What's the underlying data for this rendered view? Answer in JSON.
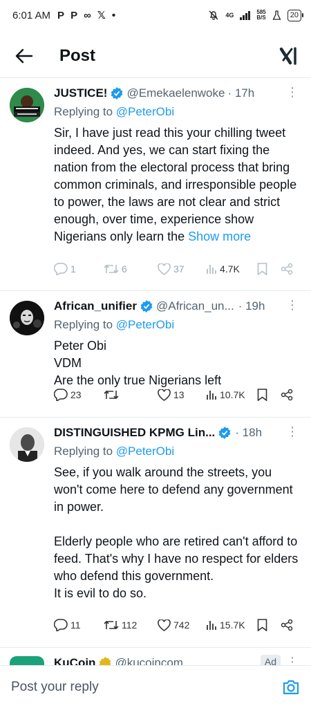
{
  "status": {
    "time": "6:01 AM",
    "left_icons": [
      "P",
      "P",
      "∞",
      "𝕏",
      "•"
    ],
    "net_gen": "4G",
    "net_speed_top": "585",
    "net_speed_bottom": "B/S",
    "battery": "20"
  },
  "header": {
    "title": "Post",
    "logo": "xl"
  },
  "tweets": [
    {
      "name": "JUSTICE!",
      "handle": "@Emekaelenwoke",
      "time": "· 17h",
      "reply_prefix": "Replying to ",
      "reply_to": "@PeterObi",
      "text": "Sir, I have just read this your chilling tweet indeed. And yes, we can start fixing the nation from the electoral process that bring common criminals, and irresponsible people to power, the laws are not clear and strict enough, over time, experience show Nigerians only learn the ",
      "show_more": "Show more",
      "replies": "1",
      "reposts": "6",
      "likes": "37",
      "views": "4.7K"
    },
    {
      "name": "African_unifier",
      "handle": "@African_un...",
      "time": "· 19h",
      "reply_prefix": "Replying to ",
      "reply_to": "@PeterObi",
      "text": "Peter Obi\nVDM\n Are the only true Nigerians left",
      "replies": "23",
      "reposts": "",
      "likes": "13",
      "views": "10.7K"
    },
    {
      "name": "DISTINGUISHED KPMG Lin...",
      "handle": "",
      "time": "· 18h",
      "reply_prefix": "Replying to ",
      "reply_to": "@PeterObi",
      "text": "See, if you walk around the streets, you won't come here to defend any government in power.\n\nElderly people who are retired can't afford to feed. That's why I have no respect for elders who defend this government.\nIt is evil to do so.",
      "replies": "11",
      "reposts": "112",
      "likes": "742",
      "views": "15.7K"
    },
    {
      "name": "KuCoin",
      "handle": "@kucoincom",
      "badge": "Ad"
    }
  ],
  "reply_bar": {
    "placeholder": "Post your reply"
  },
  "colors": {
    "accent": "#1d9bf0",
    "verified_blue": "#1d9bf0",
    "verified_gold": "#e2b719",
    "muted": "#536471"
  }
}
